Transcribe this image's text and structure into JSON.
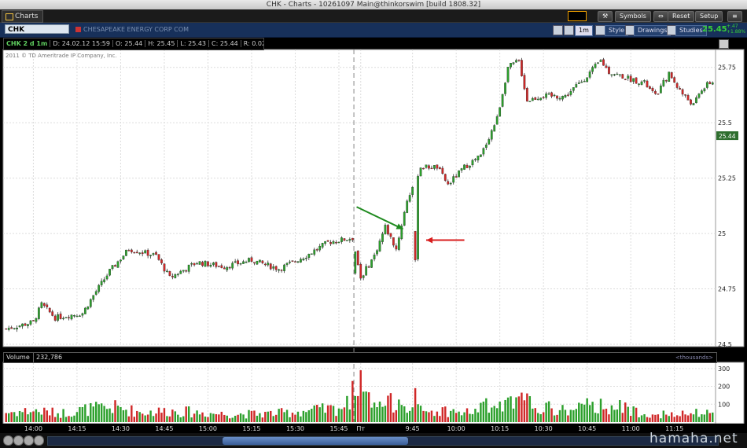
{
  "window": {
    "title": "CHK - Charts - 10261097 Main@thinkorswim [build 1808.32]"
  },
  "toolbar": {
    "tab_label": "Charts",
    "buttons": [
      "Symbols",
      "Reset",
      "Setup"
    ]
  },
  "header": {
    "symbol": "CHK",
    "company": "CHESAPEAKE ENERGY CORP COM",
    "timeframe_button": "1m",
    "buttons": [
      "Style",
      "Drawings",
      "Studies"
    ],
    "last_price": "25.45",
    "change_abs": "+.47",
    "change_pct": "+1.88%"
  },
  "info": {
    "ticker": "CHK 2 d 1m",
    "date": "D: 24.02.12 15:59",
    "open": "O: 25.44",
    "high": "H: 25.45",
    "low": "L: 25.43",
    "close": "C: 25.44",
    "range": "R: 0.02"
  },
  "copyright": "2011 © TD Ameritrade IP Company, Inc.",
  "volume": {
    "label": "Volume",
    "value": "232,786",
    "unit": "<thousands>"
  },
  "watermark": "hamaha.net",
  "colors": {
    "up": "#2ca02c",
    "down": "#d02828",
    "background": "#ffffff",
    "arrow_green": "#1f8a1f",
    "arrow_red": "#d81e1e",
    "price_tag": "#2e6e2e"
  },
  "chart_data": {
    "type": "candlestick",
    "title": "",
    "y_ticks": [
      "24.5",
      "24.75",
      "25",
      "25.25",
      "25.5",
      "25.75"
    ],
    "ylim": [
      24.5,
      25.82
    ],
    "current_price_tag": "25.44",
    "x_ticks": [
      "14:00",
      "14:15",
      "14:30",
      "14:45",
      "15:00",
      "15:15",
      "15:30",
      "15:45",
      "Пт",
      "9:45",
      "10:00",
      "10:15",
      "10:30",
      "10:45",
      "11:00",
      "11:15"
    ],
    "session_break_label": "Пт",
    "anchors_close": [
      [
        0,
        24.57
      ],
      [
        10,
        24.6
      ],
      [
        13,
        24.68
      ],
      [
        18,
        24.62
      ],
      [
        28,
        24.64
      ],
      [
        32,
        24.72
      ],
      [
        38,
        24.83
      ],
      [
        45,
        24.93
      ],
      [
        55,
        24.9
      ],
      [
        60,
        24.8
      ],
      [
        70,
        24.87
      ],
      [
        80,
        24.85
      ],
      [
        90,
        24.88
      ],
      [
        100,
        24.84
      ],
      [
        110,
        24.9
      ],
      [
        118,
        24.96
      ],
      [
        127,
        24.98
      ],
      [
        130,
        24.8
      ],
      [
        135,
        24.9
      ],
      [
        139,
        25.03
      ],
      [
        143,
        24.93
      ],
      [
        147,
        25.15
      ],
      [
        152,
        25.3
      ],
      [
        158,
        25.3
      ],
      [
        162,
        25.22
      ],
      [
        168,
        25.3
      ],
      [
        174,
        25.35
      ],
      [
        180,
        25.52
      ],
      [
        184,
        25.75
      ],
      [
        188,
        25.78
      ],
      [
        191,
        25.6
      ],
      [
        196,
        25.62
      ],
      [
        205,
        25.62
      ],
      [
        212,
        25.7
      ],
      [
        218,
        25.78
      ],
      [
        221,
        25.73
      ],
      [
        228,
        25.7
      ],
      [
        234,
        25.68
      ],
      [
        238,
        25.62
      ],
      [
        243,
        25.72
      ],
      [
        248,
        25.63
      ],
      [
        252,
        25.58
      ],
      [
        255,
        25.65
      ],
      [
        258,
        25.68
      ]
    ],
    "anchors_volume": [
      [
        0,
        60
      ],
      [
        10,
        70
      ],
      [
        20,
        55
      ],
      [
        30,
        80
      ],
      [
        40,
        90
      ],
      [
        50,
        60
      ],
      [
        60,
        70
      ],
      [
        70,
        60
      ],
      [
        80,
        50
      ],
      [
        90,
        50
      ],
      [
        100,
        55
      ],
      [
        110,
        70
      ],
      [
        120,
        80
      ],
      [
        127,
        120
      ],
      [
        130,
        180
      ],
      [
        135,
        100
      ],
      [
        140,
        110
      ],
      [
        145,
        150
      ],
      [
        150,
        80
      ],
      [
        155,
        60
      ],
      [
        160,
        70
      ],
      [
        165,
        60
      ],
      [
        170,
        60
      ],
      [
        175,
        100
      ],
      [
        180,
        90
      ],
      [
        185,
        110
      ],
      [
        190,
        130
      ],
      [
        195,
        100
      ],
      [
        200,
        80
      ],
      [
        205,
        70
      ],
      [
        210,
        90
      ],
      [
        215,
        100
      ],
      [
        220,
        110
      ],
      [
        225,
        90
      ],
      [
        230,
        70
      ],
      [
        235,
        60
      ],
      [
        240,
        50
      ],
      [
        245,
        40
      ],
      [
        250,
        50
      ],
      [
        258,
        60
      ]
    ],
    "volume_y_ticks": [
      "100",
      "200",
      "300"
    ],
    "volume_ylim": [
      0,
      330
    ],
    "annotations": [
      {
        "type": "arrow",
        "color": "green",
        "from": [
          128.5,
          25.12
        ],
        "to": [
          145.5,
          25.02
        ]
      },
      {
        "type": "arrow",
        "color": "red",
        "from": [
          168,
          24.97
        ],
        "to": [
          154,
          24.97
        ]
      }
    ]
  }
}
